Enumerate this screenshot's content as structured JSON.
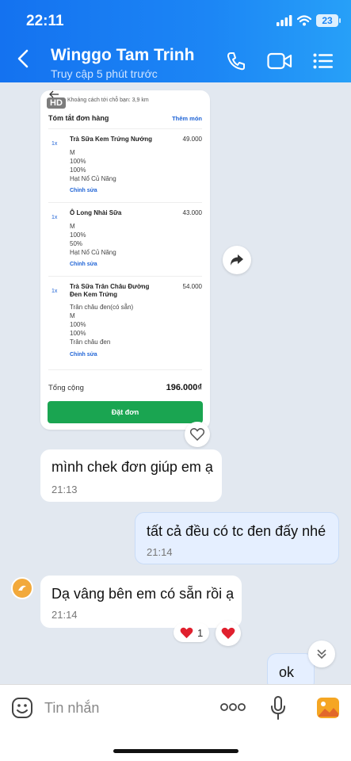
{
  "status_bar": {
    "time": "22:11",
    "battery": "23"
  },
  "header": {
    "title": "Winggo Tam Trinh",
    "subtitle": "Truy cập 5 phút trước"
  },
  "order_image": {
    "hd_badge": "HD",
    "distance": "Khoảng cách tới chỗ bạn: 3,9 km",
    "summary_title": "Tóm tắt đơn hàng",
    "add_more": "Thêm món",
    "items": [
      {
        "qty": "1x",
        "name": "Trà Sữa Kem Trứng Nướng",
        "price": "49.000",
        "options": [
          "M",
          "100%",
          "100%",
          "Hạt Nổ Củ Năng"
        ],
        "edit": "Chỉnh sửa"
      },
      {
        "qty": "1x",
        "name": "Ô Long Nhài Sữa",
        "price": "43.000",
        "options": [
          "M",
          "100%",
          "50%",
          "Hạt Nổ Củ Năng"
        ],
        "edit": "Chỉnh sửa"
      },
      {
        "qty": "1x",
        "name": "Trà Sữa Trân Châu Đường Đen Kem Trứng",
        "price": "54.000",
        "options": [
          "Trân châu đen(có sẵn)",
          "M",
          "100%",
          "100%",
          "Trân châu đen"
        ],
        "edit": "Chỉnh sửa"
      }
    ],
    "total_label": "Tổng cộng",
    "total_value": "196.000₫",
    "order_button": "Đặt đơn"
  },
  "messages": [
    {
      "side": "in",
      "text": "mình chek đơn giúp em ạ",
      "time": "21:13"
    },
    {
      "side": "out",
      "text": "tất cả đều có tc đen đấy nhé",
      "time": "21:14"
    },
    {
      "side": "in",
      "text": "Dạ vâng bên em có sẵn rồi ạ",
      "time": "21:14"
    },
    {
      "side": "out",
      "text": "ok",
      "time": ""
    }
  ],
  "reaction": {
    "count": "1"
  },
  "input": {
    "placeholder": "Tin nhắn"
  },
  "colors": {
    "header": "#1c86f5",
    "order_button": "#1aa551",
    "heart": "#e0202e",
    "outgoing_bubble": "#e5efff"
  }
}
